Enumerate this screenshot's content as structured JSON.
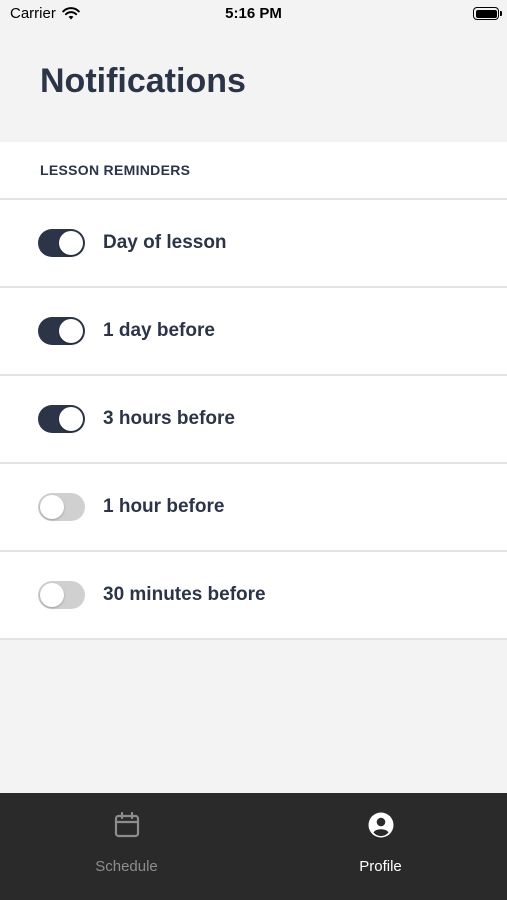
{
  "status_bar": {
    "carrier": "Carrier",
    "time": "5:16 PM",
    "wifi_icon": "wifi-icon",
    "battery_icon": "battery-icon"
  },
  "page": {
    "title": "Notifications"
  },
  "section": {
    "header": "LESSON REMINDERS",
    "items": [
      {
        "label": "Day of lesson",
        "enabled": true
      },
      {
        "label": "1 day before",
        "enabled": true
      },
      {
        "label": "3 hours before",
        "enabled": true
      },
      {
        "label": "1 hour before",
        "enabled": false
      },
      {
        "label": "30 minutes before",
        "enabled": false
      }
    ]
  },
  "tab_bar": {
    "tabs": [
      {
        "label": "Schedule",
        "icon": "calendar-icon",
        "active": false
      },
      {
        "label": "Profile",
        "icon": "user-circle-icon",
        "active": true
      }
    ]
  },
  "colors": {
    "primary": "#2c3448",
    "toggle_off": "#d0d0d0",
    "background": "#f3f3f3",
    "tab_bar": "#2a2a2a",
    "tab_inactive": "#8d8d8d",
    "tab_active": "#ffffff"
  }
}
